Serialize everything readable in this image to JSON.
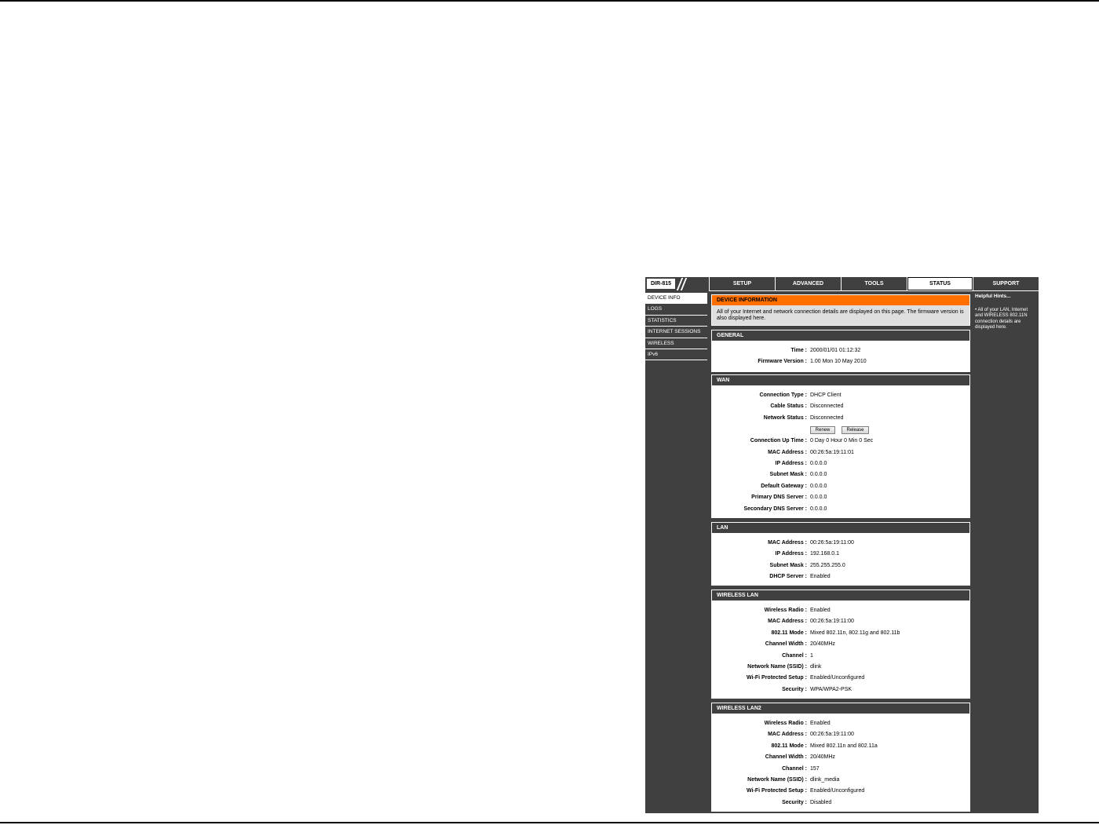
{
  "window": {
    "model": "DIR-815"
  },
  "top_nav": {
    "tabs": [
      {
        "label": "SETUP",
        "active": false
      },
      {
        "label": "ADVANCED",
        "active": false
      },
      {
        "label": "TOOLS",
        "active": false
      },
      {
        "label": "STATUS",
        "active": true
      },
      {
        "label": "SUPPORT",
        "active": false
      }
    ]
  },
  "sidebar": {
    "items": [
      {
        "label": "DEVICE INFO",
        "active": true
      },
      {
        "label": "LOGS",
        "active": false
      },
      {
        "label": "STATISTICS",
        "active": false
      },
      {
        "label": "INTERNET SESSIONS",
        "active": false
      },
      {
        "label": "WIRELESS",
        "active": false
      },
      {
        "label": "IPv6",
        "active": false
      }
    ]
  },
  "device_info": {
    "title": "DEVICE INFORMATION",
    "description": "All of your Internet and network connection details are displayed on this page. The firmware version is also displayed here."
  },
  "general": {
    "title": "GENERAL",
    "rows": [
      {
        "label": "Time :",
        "value": "2000/01/01 01:12:32"
      },
      {
        "label": "Firmware Version :",
        "value": "1.00 Mon 10 May 2010"
      }
    ]
  },
  "wan": {
    "title": "WAN",
    "rows": [
      {
        "label": "Connection Type :",
        "value": "DHCP Client"
      },
      {
        "label": "Cable Status :",
        "value": "Disconnected"
      },
      {
        "label": "Network Status :",
        "value": "Disconnected"
      },
      {
        "label": "Connection Up Time :",
        "value": "0 Day 0 Hour 0 Min 0 Sec"
      },
      {
        "label": "MAC Address :",
        "value": "00:26:5a:19:11:01"
      },
      {
        "label": "IP Address :",
        "value": "0.0.0.0"
      },
      {
        "label": "Subnet Mask :",
        "value": "0.0.0.0"
      },
      {
        "label": "Default Gateway :",
        "value": "0.0.0.0"
      },
      {
        "label": "Primary DNS Server :",
        "value": "0.0.0.0"
      },
      {
        "label": "Secondary DNS Server :",
        "value": "0.0.0.0"
      }
    ],
    "renew_label": "Renew",
    "release_label": "Release"
  },
  "lan": {
    "title": "LAN",
    "rows": [
      {
        "label": "MAC Address :",
        "value": "00:26:5a:19:11:00"
      },
      {
        "label": "IP Address :",
        "value": "192.168.0.1"
      },
      {
        "label": "Subnet Mask :",
        "value": "255.255.255.0"
      },
      {
        "label": "DHCP Server :",
        "value": "Enabled"
      }
    ]
  },
  "wireless_lan": {
    "title": "WIRELESS LAN",
    "rows": [
      {
        "label": "Wireless Radio :",
        "value": "Enabled"
      },
      {
        "label": "MAC Address :",
        "value": "00:26:5a:19:11:00"
      },
      {
        "label": "802.11 Mode :",
        "value": "Mixed 802.11n, 802.11g and 802.11b"
      },
      {
        "label": "Channel Width :",
        "value": "20/40MHz"
      },
      {
        "label": "Channel :",
        "value": "1"
      },
      {
        "label": "Network Name (SSID) :",
        "value": "dlink"
      },
      {
        "label": "Wi-Fi Protected Setup :",
        "value": "Enabled/Unconfigured"
      },
      {
        "label": "Security :",
        "value": "WPA/WPA2-PSK"
      }
    ]
  },
  "wireless_lan2": {
    "title": "WIRELESS LAN2",
    "rows": [
      {
        "label": "Wireless Radio :",
        "value": "Enabled"
      },
      {
        "label": "MAC Address :",
        "value": "00:26:5a:19:11:00"
      },
      {
        "label": "802.11 Mode :",
        "value": "Mixed 802.11n and 802.11a"
      },
      {
        "label": "Channel Width :",
        "value": "20/40MHz"
      },
      {
        "label": "Channel :",
        "value": "157"
      },
      {
        "label": "Network Name (SSID) :",
        "value": "dlink_media"
      },
      {
        "label": "Wi-Fi Protected Setup :",
        "value": "Enabled/Unconfigured"
      },
      {
        "label": "Security :",
        "value": "Disabled"
      }
    ]
  },
  "hints": {
    "title": "Helpful Hints...",
    "bullet": "•",
    "text": "All of your LAN, Internet and WIRELESS 802.11N connection details are displayed here."
  },
  "colors": {
    "frame": "#404040",
    "section_header": "#404040",
    "accent_orange": "#ff6f00",
    "info_body": "#dfdfdf",
    "panel_background": "#ffffff"
  }
}
